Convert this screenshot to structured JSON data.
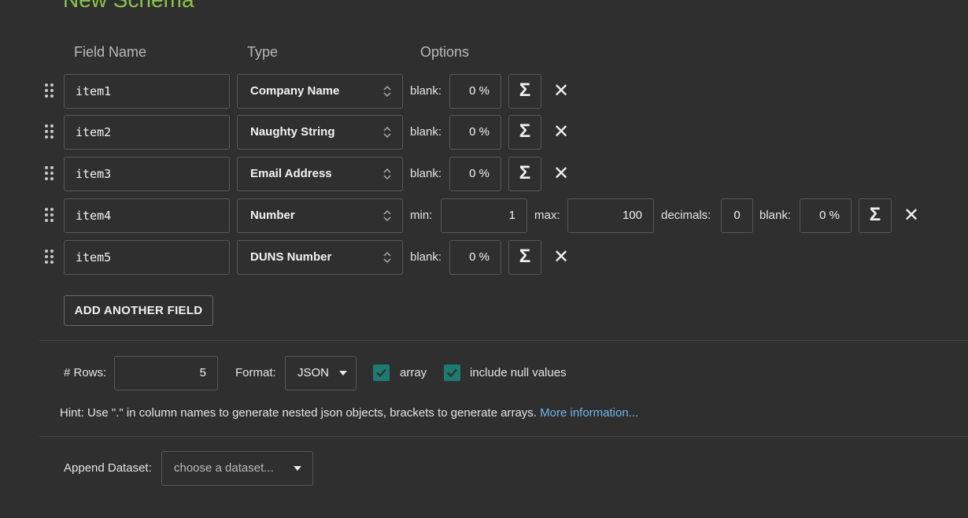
{
  "header": {
    "title": "New Schema"
  },
  "columns": {
    "field_name": "Field Name",
    "type": "Type",
    "options": "Options"
  },
  "icons": {
    "drag": "drag-handle-icon",
    "sigma": "sigma-icon",
    "remove": "close-icon",
    "chevron": "chevron-updown-icon",
    "check": "check-icon",
    "caret": "caret-down-icon"
  },
  "fields": [
    {
      "name": "item1",
      "type": "Company Name",
      "blank_label": "blank:",
      "blank_value": "0 %",
      "sigma": "Σ",
      "remove": "✕"
    },
    {
      "name": "item2",
      "type": "Naughty String",
      "blank_label": "blank:",
      "blank_value": "0 %",
      "sigma": "Σ",
      "remove": "✕"
    },
    {
      "name": "item3",
      "type": "Email Address",
      "blank_label": "blank:",
      "blank_value": "0 %",
      "sigma": "Σ",
      "remove": "✕"
    },
    {
      "name": "item4",
      "type": "Number",
      "min_label": "min:",
      "min_value": "1",
      "max_label": "max:",
      "max_value": "100",
      "decimals_label": "decimals:",
      "decimals_value": "0",
      "blank_label": "blank:",
      "blank_value": "0 %",
      "sigma": "Σ",
      "remove": "✕"
    },
    {
      "name": "item5",
      "type": "DUNS Number",
      "blank_label": "blank:",
      "blank_value": "0 %",
      "sigma": "Σ",
      "remove": "✕"
    }
  ],
  "add_field_label": "ADD ANOTHER FIELD",
  "settings": {
    "rows_label": "# Rows:",
    "rows_value": "5",
    "format_label": "Format:",
    "format_value": "JSON",
    "array_label": "array",
    "array_checked": true,
    "include_null_label": "include null values",
    "include_null_checked": true
  },
  "hint": {
    "text": "Hint: Use \".\" in column names to generate nested json objects, brackets to generate arrays.",
    "link": "More information..."
  },
  "append": {
    "label": "Append Dataset:",
    "placeholder": "choose a dataset..."
  },
  "colors": {
    "background": "#2f2f2f",
    "title": "#8bc34a",
    "checkbox": "#1f7a72",
    "link": "#6fb3e8",
    "border": "#575757"
  }
}
